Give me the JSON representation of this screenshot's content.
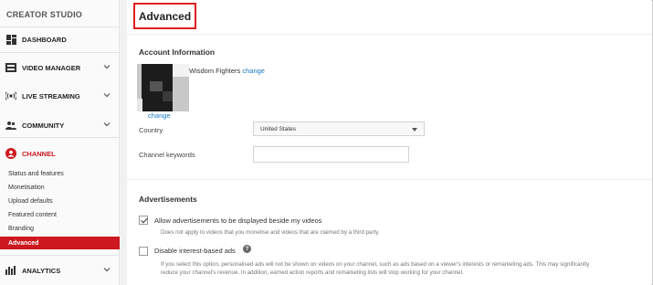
{
  "sidebar": {
    "title": "CREATOR STUDIO",
    "items": [
      {
        "label": "DASHBOARD"
      },
      {
        "label": "VIDEO MANAGER"
      },
      {
        "label": "LIVE STREAMING"
      },
      {
        "label": "COMMUNITY"
      },
      {
        "label": "CHANNEL"
      },
      {
        "label": "ANALYTICS"
      }
    ],
    "channel_subitems": [
      {
        "label": "Status and features"
      },
      {
        "label": "Monetisation"
      },
      {
        "label": "Upload defaults"
      },
      {
        "label": "Featured content"
      },
      {
        "label": "Branding"
      },
      {
        "label": "Advanced"
      }
    ],
    "active_item": "CHANNEL",
    "selected_subitem": "Advanced"
  },
  "main": {
    "page_title": "Advanced",
    "account_section": {
      "title": "Account Information",
      "channel_name": "Wisdom Fighters",
      "change_link": "change",
      "avatar_change_link": "change",
      "country_label": "Country",
      "country_value": "United States",
      "keywords_label": "Channel keywords",
      "keywords_value": ""
    },
    "ads_section": {
      "title": "Advertisements",
      "allow_ads_label": "Allow advertisements to be displayed beside my videos",
      "allow_ads_checked": true,
      "allow_ads_help": "Does not apply to videos that you monetise and videos that are claimed by a third party.",
      "interest_ads_label": "Disable interest-based ads",
      "interest_ads_checked": false,
      "interest_ads_help_icon": "?",
      "interest_ads_help_line1": "If you select this option, personalised ads will not be shown on videos on your channel, such as ads based on a viewer's interests or remarketing ads. This may significantly",
      "interest_ads_help_line2": "reduce your channel's revenue. In addition, earned action reports and remarketing lists will stop working for your channel."
    }
  },
  "colors": {
    "accent_red": "#cc181e",
    "title_highlight": "#e01b22",
    "link_blue": "#167ac6"
  }
}
